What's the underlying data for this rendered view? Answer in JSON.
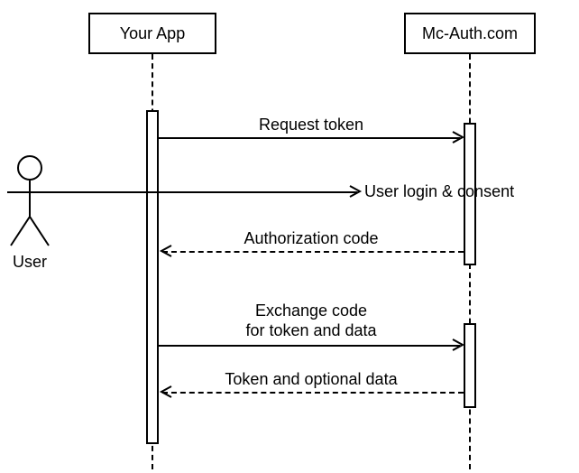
{
  "participants": {
    "app": "Your App",
    "mcauth": "Mc-Auth.com"
  },
  "actor": {
    "label": "User"
  },
  "messages": {
    "m1": "Request token",
    "m2": "User login & consent",
    "m3": "Authorization code",
    "m4a": "Exchange code",
    "m4b": "for token and data",
    "m5": "Token and optional data"
  }
}
